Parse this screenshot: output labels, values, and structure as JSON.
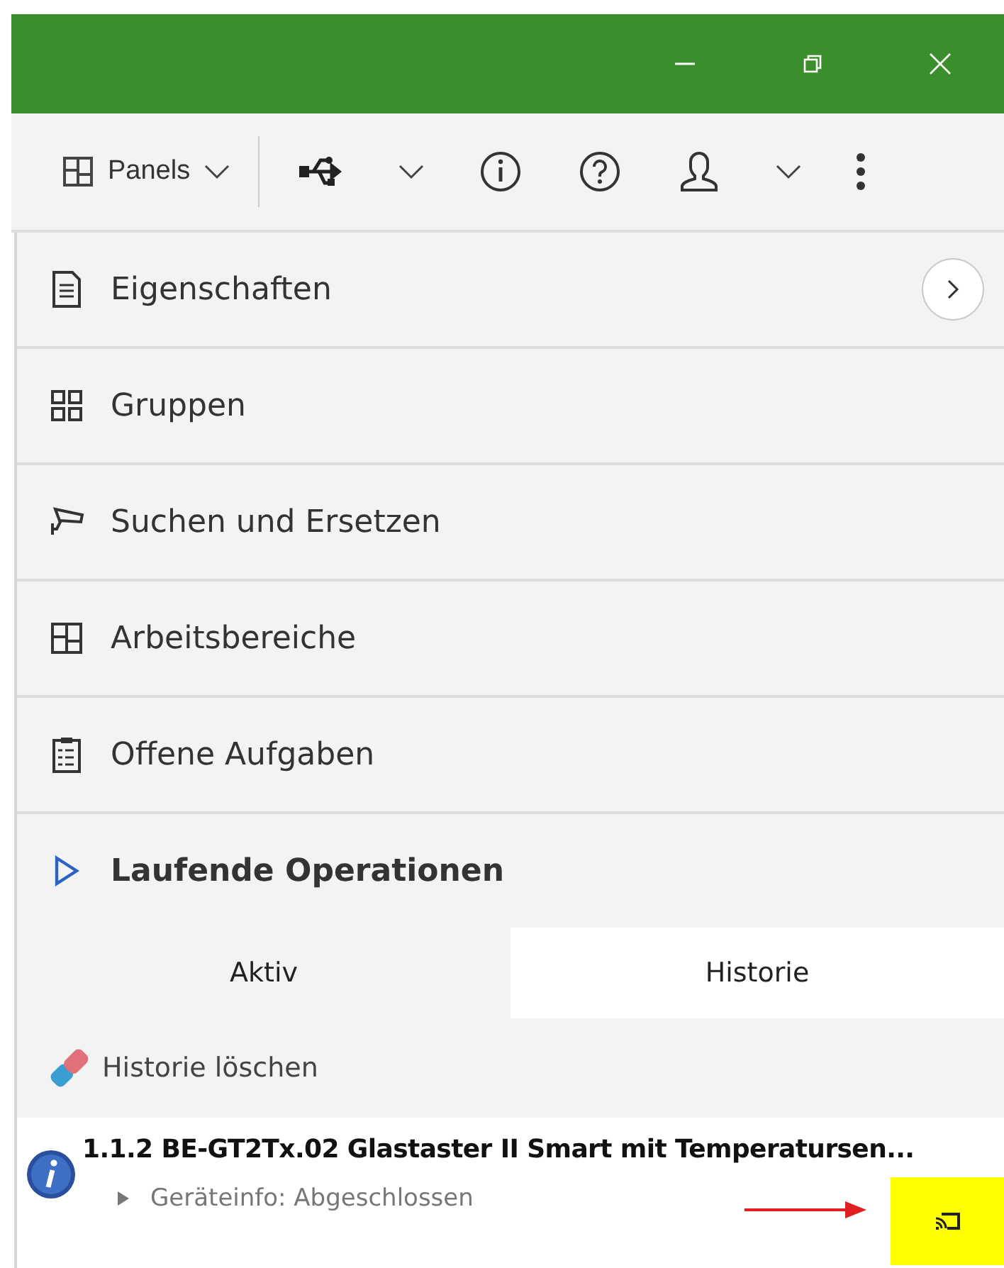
{
  "toolbar": {
    "panels_label": "Panels"
  },
  "panels": [
    {
      "label": "Eigenschaften",
      "kind": "panel",
      "expand_button": true
    },
    {
      "label": "Gruppen",
      "kind": "panel",
      "expand_button": false
    },
    {
      "label": "Suchen und Ersetzen",
      "kind": "panel",
      "expand_button": false
    },
    {
      "label": "Arbeitsbereiche",
      "kind": "panel",
      "expand_button": false
    },
    {
      "label": "Offene Aufgaben",
      "kind": "panel",
      "expand_button": false
    },
    {
      "label": "Laufende Operationen",
      "kind": "section",
      "expand_button": false
    }
  ],
  "tabs": [
    {
      "label": "Aktiv",
      "selected": false
    },
    {
      "label": "Historie",
      "selected": true
    }
  ],
  "clear_history": "Historie löschen",
  "history": [
    {
      "title": "1.1.2 BE-GT2Tx.02 Glastaster II Smart mit Temperatursen...",
      "detail": "Geräteinfo: Abgeschlossen"
    }
  ]
}
